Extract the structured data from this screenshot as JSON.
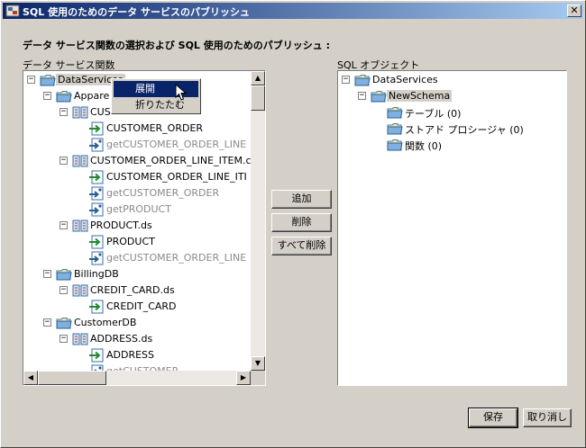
{
  "window": {
    "title": "SQL 使用のためのデータ サービスのパブリッシュ",
    "close_glyph": "✕"
  },
  "heading": "データ サービス関数の選択および SQL 使用のためのパブリッシュ :",
  "left_tree": {
    "label": "データ サービス関数",
    "nodes": [
      {
        "label": "DataServices",
        "icon": "folder-icon",
        "gray": false
      },
      {
        "label": "Appare",
        "icon": "folder-icon",
        "gray": false
      },
      {
        "label": "CUS",
        "icon": "dataservice-icon",
        "gray": false
      },
      {
        "label": "CUSTOMER_ORDER",
        "icon": "function-icon",
        "gray": false
      },
      {
        "label": "getCUSTOMER_ORDER_LINE",
        "icon": "navigate-function-icon",
        "gray": true
      },
      {
        "label": "CUSTOMER_ORDER_LINE_ITEM.c",
        "icon": "dataservice-icon",
        "gray": false
      },
      {
        "label": "CUSTOMER_ORDER_LINE_ITI",
        "icon": "function-icon",
        "gray": false
      },
      {
        "label": "getCUSTOMER_ORDER",
        "icon": "navigate-function-icon",
        "gray": true
      },
      {
        "label": "getPRODUCT",
        "icon": "navigate-function-icon",
        "gray": true
      },
      {
        "label": "PRODUCT.ds",
        "icon": "dataservice-icon",
        "gray": false
      },
      {
        "label": "PRODUCT",
        "icon": "function-icon",
        "gray": false
      },
      {
        "label": "getCUSTOMER_ORDER_LINE",
        "icon": "navigate-function-icon",
        "gray": true
      },
      {
        "label": "BillingDB",
        "icon": "folder-icon",
        "gray": false
      },
      {
        "label": "CREDIT_CARD.ds",
        "icon": "dataservice-icon",
        "gray": false
      },
      {
        "label": "CREDIT_CARD",
        "icon": "function-icon",
        "gray": false
      },
      {
        "label": "CustomerDB",
        "icon": "folder-icon",
        "gray": false
      },
      {
        "label": "ADDRESS.ds",
        "icon": "dataservice-icon",
        "gray": false
      },
      {
        "label": "ADDRESS",
        "icon": "function-icon",
        "gray": false
      },
      {
        "label": "getCUSTOMER",
        "icon": "navigate-function-icon",
        "gray": true
      }
    ]
  },
  "right_tree": {
    "label": "SQL オブジェクト",
    "nodes": [
      {
        "label": "DataServices",
        "icon": "folder-icon"
      },
      {
        "label": "NewSchema",
        "icon": "folder-icon"
      },
      {
        "label": "テーブル (0)",
        "icon": "folder-icon"
      },
      {
        "label": "ストアド プロシージャ (0)",
        "icon": "folder-icon"
      },
      {
        "label": "関数 (0)",
        "icon": "folder-icon"
      }
    ]
  },
  "context_menu": {
    "items": [
      "展開",
      "折りたたむ"
    ]
  },
  "middle_buttons": {
    "add": "追加",
    "remove": "削除",
    "remove_all": "すべて削除"
  },
  "footer_buttons": {
    "save": "保存",
    "cancel": "取り消し"
  },
  "scroll": {
    "left_up": "▲",
    "left_down": "▼",
    "left_left": "◀",
    "left_right": "▶"
  }
}
